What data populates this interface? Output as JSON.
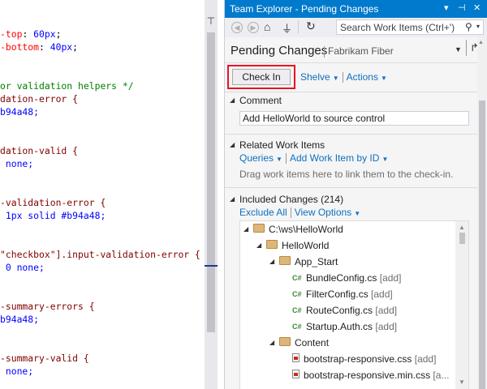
{
  "editor": {
    "lines": [
      [
        {
          "t": "-top",
          "c": "c-prop"
        },
        {
          "t": ": ",
          "c": "c-txt"
        },
        {
          "t": "60px",
          "c": "c-val"
        },
        {
          "t": ";",
          "c": "c-txt"
        }
      ],
      [
        {
          "t": "-bottom",
          "c": "c-prop"
        },
        {
          "t": ": ",
          "c": "c-txt"
        },
        {
          "t": "40px",
          "c": "c-val"
        },
        {
          "t": ";",
          "c": "c-txt"
        }
      ],
      [],
      [],
      [
        {
          "t": "or validation helpers */",
          "c": "c-com"
        }
      ],
      [
        {
          "t": "dation-error {",
          "c": "c-sel"
        }
      ],
      [
        {
          "t": "b94a48;",
          "c": "c-val"
        }
      ],
      [],
      [],
      [
        {
          "t": "dation-valid {",
          "c": "c-sel"
        }
      ],
      [
        {
          "t": "",
          "c": "c-txt"
        },
        {
          "t": " none;",
          "c": "c-val"
        }
      ],
      [],
      [],
      [
        {
          "t": "-validation-error {",
          "c": "c-sel"
        }
      ],
      [
        {
          "t": " 1px solid #b94a48;",
          "c": "c-val"
        }
      ],
      [],
      [],
      [
        {
          "t": "\"checkbox\"].input-validation-error {",
          "c": "c-sel"
        }
      ],
      [
        {
          "t": " 0 none;",
          "c": "c-val"
        }
      ],
      [],
      [],
      [
        {
          "t": "-summary-errors {",
          "c": "c-sel"
        }
      ],
      [
        {
          "t": "b94a48;",
          "c": "c-val"
        }
      ],
      [],
      [],
      [
        {
          "t": "-summary-valid {",
          "c": "c-sel"
        }
      ],
      [
        {
          "t": " none;",
          "c": "c-val"
        }
      ]
    ]
  },
  "team_explorer": {
    "title": "Team Explorer - Pending Changes",
    "title_glyphs": {
      "dropdown": "▾",
      "pin": "⊣",
      "close": "✕"
    },
    "search": {
      "placeholder": "Search Work Items (Ctrl+')"
    },
    "page": {
      "title": "Pending Changes",
      "subtitle": "Fabrikam Fiber"
    },
    "actions": {
      "checkin": "Check In",
      "shelve": "Shelve",
      "actions": "Actions"
    },
    "comment": {
      "heading": "Comment",
      "value": "Add HelloWorld to source control"
    },
    "related": {
      "heading": "Related Work Items",
      "queries": "Queries",
      "add_by_id": "Add Work Item by ID",
      "help": "Drag work items here to link them to the check-in."
    },
    "included": {
      "heading": "Included Changes (214)",
      "exclude_all": "Exclude All",
      "view_options": "View Options",
      "tree": [
        {
          "level": 0,
          "kind": "folder",
          "name": "C:\\ws\\HelloWorld",
          "tag": ""
        },
        {
          "level": 1,
          "kind": "folder",
          "name": "HelloWorld",
          "tag": ""
        },
        {
          "level": 2,
          "kind": "folder",
          "name": "App_Start",
          "tag": ""
        },
        {
          "level": 3,
          "kind": "cs",
          "name": "BundleConfig.cs",
          "tag": "[add]"
        },
        {
          "level": 3,
          "kind": "cs",
          "name": "FilterConfig.cs",
          "tag": "[add]"
        },
        {
          "level": 3,
          "kind": "cs",
          "name": "RouteConfig.cs",
          "tag": "[add]"
        },
        {
          "level": 3,
          "kind": "cs",
          "name": "Startup.Auth.cs",
          "tag": "[add]"
        },
        {
          "level": 2,
          "kind": "folder",
          "name": "Content",
          "tag": ""
        },
        {
          "level": 3,
          "kind": "css",
          "name": "bootstrap-responsive.css",
          "tag": "[add]"
        },
        {
          "level": 3,
          "kind": "css",
          "name": "bootstrap-responsive.min.css",
          "tag": "[a..."
        }
      ]
    }
  },
  "colors": {
    "accent": "#007acc",
    "link": "#0e70c0",
    "highlight": "#e81123"
  }
}
